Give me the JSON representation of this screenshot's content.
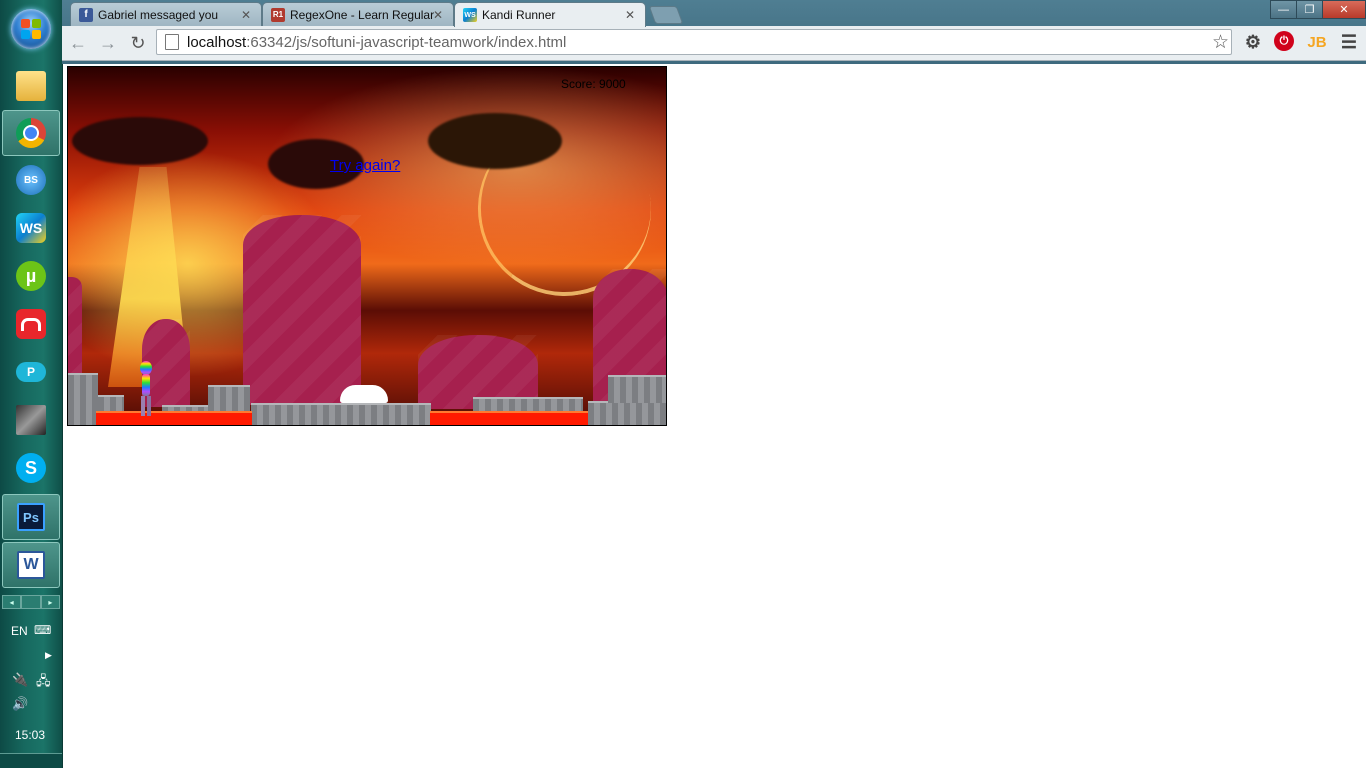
{
  "taskbar": {
    "items": [
      {
        "name": "windows-explorer",
        "icon": "folder-icon"
      },
      {
        "name": "google-chrome",
        "icon": "chrome-icon",
        "active": true
      },
      {
        "name": "app-bs",
        "icon": "bs-icon",
        "label": "BS"
      },
      {
        "name": "webstorm",
        "icon": "webstorm-icon",
        "label": "WS"
      },
      {
        "name": "utorrent",
        "icon": "utorrent-icon",
        "label": "µ"
      },
      {
        "name": "app-red",
        "icon": "red-app-icon"
      },
      {
        "name": "app-cloud-p",
        "icon": "cloud-p-icon",
        "label": "P"
      },
      {
        "name": "avatar-app",
        "icon": "avatar-icon"
      },
      {
        "name": "skype",
        "icon": "skype-icon",
        "label": "S"
      },
      {
        "name": "photoshop",
        "icon": "photoshop-icon",
        "label": "Ps"
      },
      {
        "name": "word",
        "icon": "word-icon",
        "label": "W"
      }
    ],
    "language": "EN",
    "clock": "15:03"
  },
  "browser": {
    "tabs": [
      {
        "title": "Gabriel messaged you",
        "favicon": "facebook-icon",
        "favicon_text": "f"
      },
      {
        "title": "RegexOne - Learn Regular",
        "favicon": "regexone-icon",
        "favicon_text": "R1"
      },
      {
        "title": "Kandi Runner",
        "favicon": "webstorm-icon",
        "favicon_text": "WS",
        "active": true
      }
    ],
    "url_host": "localhost",
    "url_rest": ":63342/js/softuni-javascript-teamwork/index.html",
    "window_controls": {
      "minimize": "—",
      "restore": "❐",
      "close": "✕"
    }
  },
  "game": {
    "score_text": "Score: 9000",
    "try_again": "Try again?"
  },
  "colors": {
    "accent": "#0000ee",
    "taskbar": "#17695f",
    "pillar": "#a6204e",
    "lava": "#ff1a00"
  }
}
